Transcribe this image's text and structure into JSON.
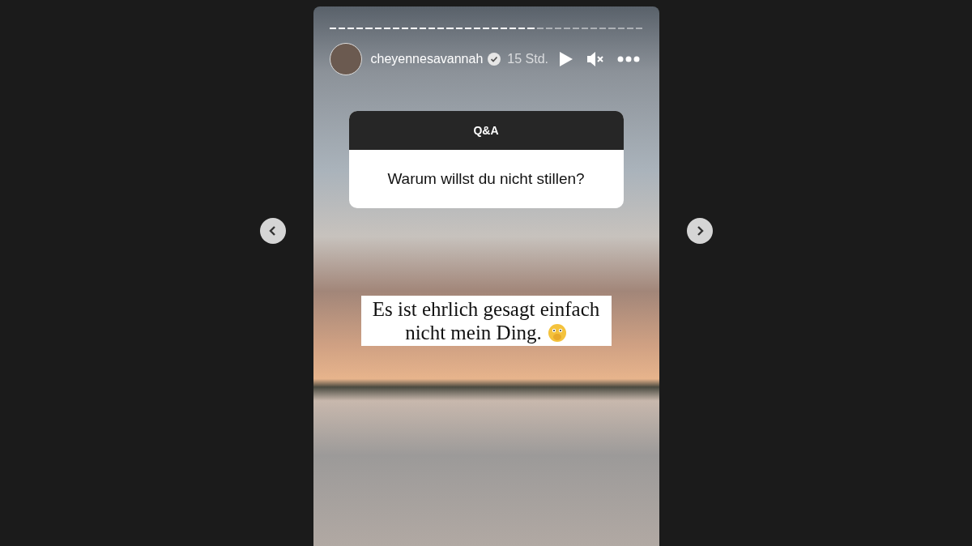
{
  "progress": [
    {
      "seen": true
    },
    {
      "seen": true
    },
    {
      "seen": true
    },
    {
      "seen": true
    },
    {
      "seen": true
    },
    {
      "seen": true
    },
    {
      "seen": true
    },
    {
      "seen": true
    },
    {
      "seen": true
    },
    {
      "seen": true
    },
    {
      "seen": true
    },
    {
      "seen": true
    },
    {
      "seen": true
    },
    {
      "seen": true
    },
    {
      "seen": true
    },
    {
      "seen": true
    },
    {
      "seen": true
    },
    {
      "seen": true
    },
    {
      "seen": true
    },
    {
      "seen": true
    },
    {
      "seen": true
    },
    {
      "seen": true
    },
    {
      "seen": true
    },
    {
      "seen": false
    },
    {
      "seen": false
    },
    {
      "seen": false
    },
    {
      "seen": false
    },
    {
      "seen": false
    },
    {
      "seen": false
    },
    {
      "seen": false
    },
    {
      "seen": false
    },
    {
      "seen": false
    },
    {
      "seen": false
    },
    {
      "seen": false
    },
    {
      "seen": false
    }
  ],
  "header": {
    "username": "cheyennesavannah",
    "verified": true,
    "time": "15 Std."
  },
  "question": {
    "title": "Q&A",
    "text": "Warum willst du nicht stillen?"
  },
  "answer": {
    "lines": [
      "Es ist ehrlich gesagt einfach",
      "nicht mein Ding."
    ]
  }
}
